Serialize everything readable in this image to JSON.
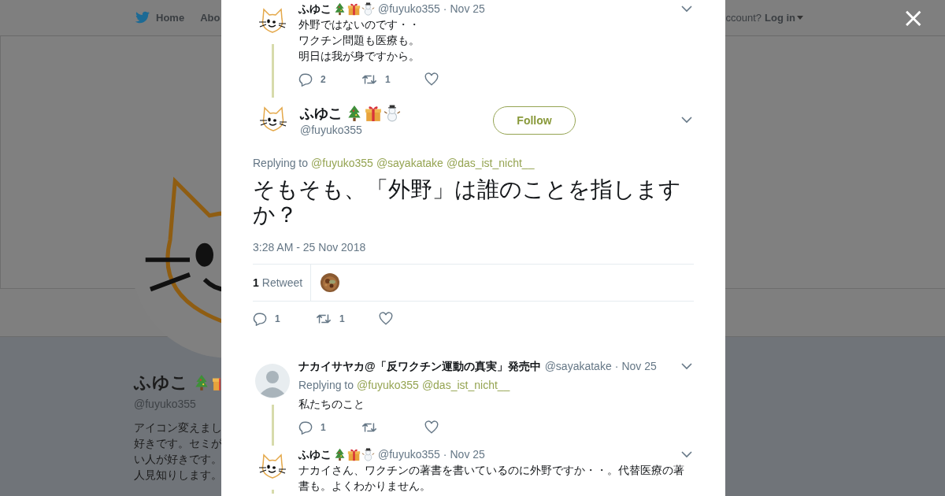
{
  "background_page": {
    "nav": [
      {
        "label": "Home",
        "icon": true
      },
      {
        "label": "Abo",
        "icon": false
      }
    ],
    "login_prompt": "ccount?",
    "login": "Log in",
    "profile": {
      "name": "ふゆこ",
      "emoji_badges": true,
      "handle": "@fuyuko355",
      "bio": [
        "アイコン変えまし",
        "好きです。セミが",
        "い人が好きです。",
        "人見知りします。"
      ]
    }
  },
  "modal": {
    "close": "×",
    "thread": [
      {
        "kind": "compact",
        "avatar": {
          "kind": "cat"
        },
        "name": "ふゆこ",
        "emoji_badges": true,
        "handle": "@fuyuko355",
        "separator": "·",
        "date": "Nov 25",
        "text_lines": [
          "外野ではないのです・・",
          "ワクチン問題も医療も。",
          "明日は我が身ですから。"
        ],
        "replies": "2",
        "retweets": "1",
        "thread_line": true
      },
      {
        "kind": "main",
        "avatar": {
          "kind": "cat"
        },
        "name": "ふゆこ",
        "emoji_badges": true,
        "handle": "@fuyuko355",
        "follow": "Follow",
        "replying_label": "Replying to",
        "replying_to": [
          "@fuyuko355",
          "@sayakatake",
          "@das_ist_nicht__"
        ],
        "text": "そもそも、「外野」は誰のことを指しますか？",
        "timestamp": "3:28 AM - 25 Nov 2018",
        "retweet_count": "1",
        "retweet_label": "Retweet",
        "replies": "1",
        "retweets": "1"
      },
      {
        "kind": "compact",
        "avatar": {
          "kind": "person"
        },
        "name": "ナカイサヤカ@「反ワクチン運動の真実」発売中",
        "emoji_badges": false,
        "handle": "@sayakatake",
        "separator": "·",
        "date": "Nov 25",
        "replying_label": "Replying to",
        "replying_to": [
          "@fuyuko355",
          "@das_ist_nicht__"
        ],
        "text_lines": [
          "私たちのこと"
        ],
        "replies": "1",
        "thread_line": true
      },
      {
        "kind": "compact",
        "avatar": {
          "kind": "cat"
        },
        "name": "ふゆこ",
        "emoji_badges": true,
        "handle": "@fuyuko355",
        "separator": "·",
        "date": "Nov 25",
        "text_lines": [
          "ナカイさん、ワクチンの著書を書いているのに外野ですか・・。代替医療の著書も。よくわかりません。"
        ],
        "thread_line": true
      }
    ]
  }
}
